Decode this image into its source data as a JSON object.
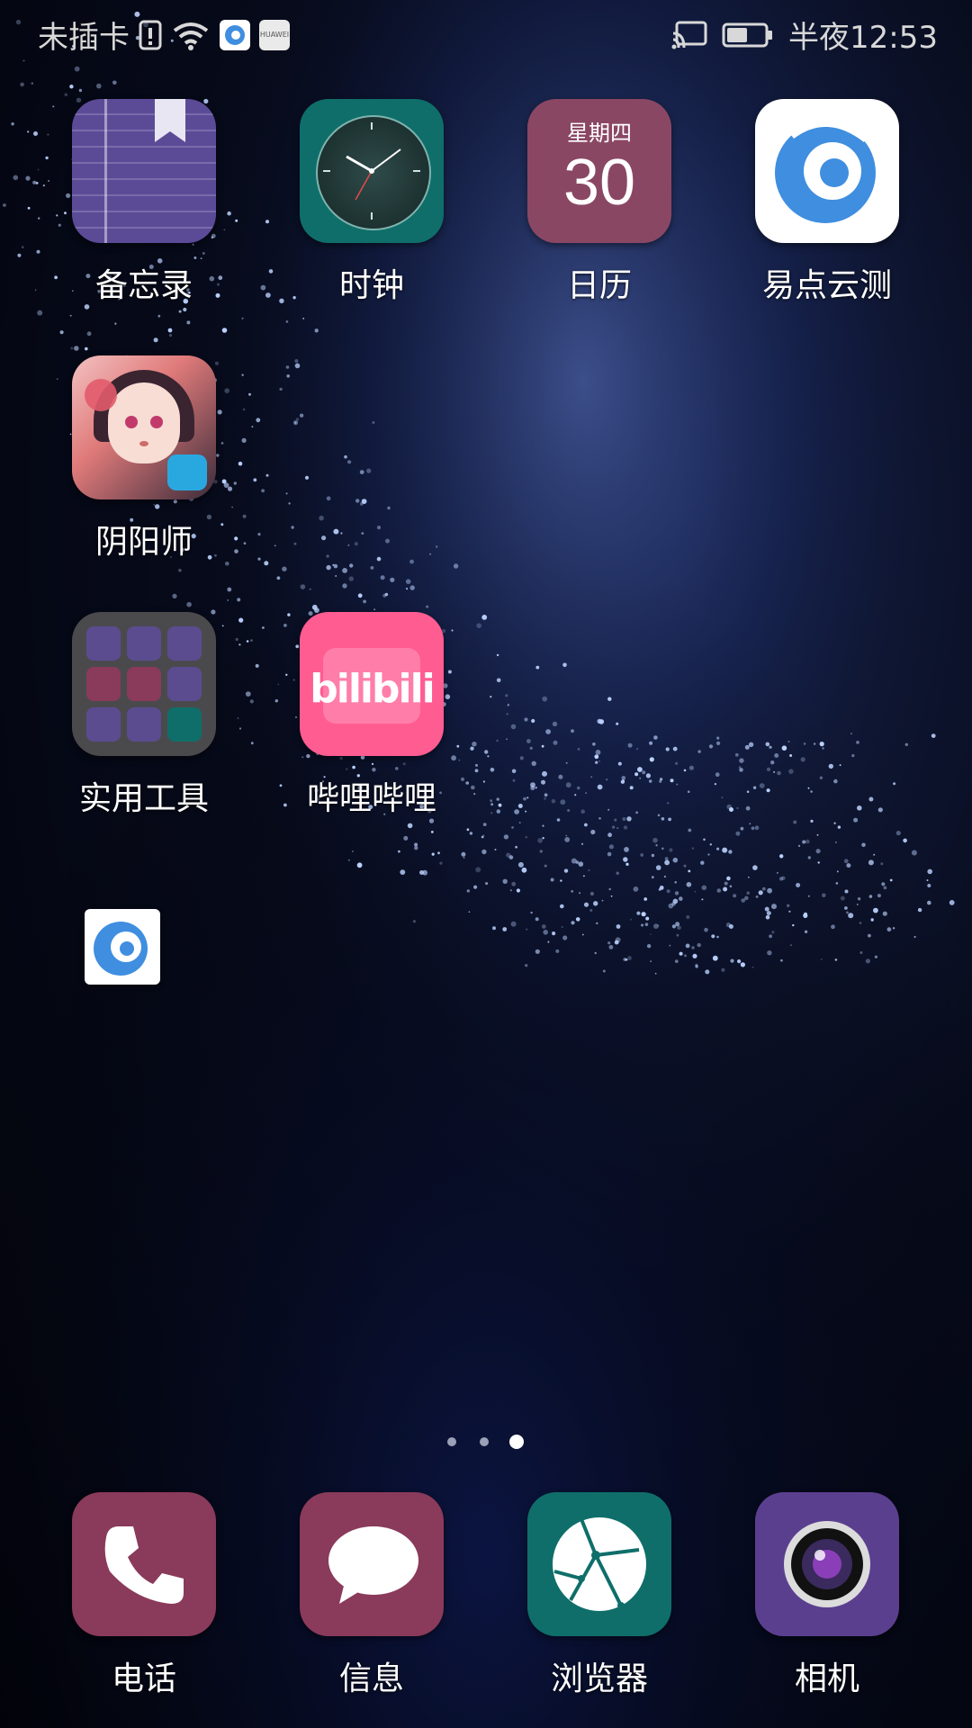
{
  "status_bar": {
    "carrier": "未插卡",
    "time": "半夜12:53",
    "huawei_text": "HUAWEI"
  },
  "apps": [
    {
      "label": "备忘录"
    },
    {
      "label": "时钟"
    },
    {
      "label": "日历",
      "weekday": "星期四",
      "day": "30"
    },
    {
      "label": "易点云测"
    },
    {
      "label": "阴阳师"
    },
    {
      "label": "实用工具"
    },
    {
      "label": "哔哩哔哩",
      "icon_text": "bilibili"
    }
  ],
  "dock": [
    {
      "label": "电话"
    },
    {
      "label": "信息"
    },
    {
      "label": "浏览器"
    },
    {
      "label": "相机"
    }
  ],
  "page_indicator": {
    "pages": 3,
    "current": 3
  }
}
